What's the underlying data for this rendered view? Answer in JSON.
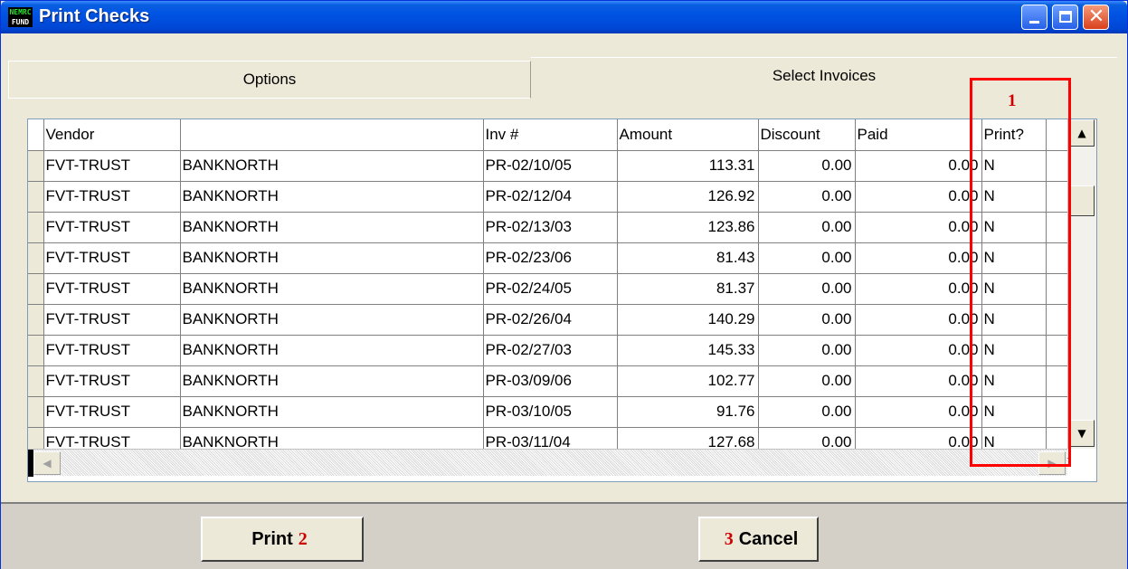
{
  "window": {
    "title": "Print Checks",
    "icon_top": "NEMRC",
    "icon_bottom": "FUND"
  },
  "tabs": [
    {
      "label": "Options",
      "active": false
    },
    {
      "label": "Select Invoices",
      "active": true
    }
  ],
  "table": {
    "headers": [
      "Vendor",
      "",
      "Inv #",
      "Amount",
      "Discount",
      "Paid",
      "Print?",
      ""
    ],
    "rows": [
      [
        "FVT-TRUST",
        "BANKNORTH",
        "PR-02/10/05",
        "113.31",
        "0.00",
        "0.00",
        "N"
      ],
      [
        "FVT-TRUST",
        "BANKNORTH",
        "PR-02/12/04",
        "126.92",
        "0.00",
        "0.00",
        "N"
      ],
      [
        "FVT-TRUST",
        "BANKNORTH",
        "PR-02/13/03",
        "123.86",
        "0.00",
        "0.00",
        "N"
      ],
      [
        "FVT-TRUST",
        "BANKNORTH",
        "PR-02/23/06",
        "81.43",
        "0.00",
        "0.00",
        "N"
      ],
      [
        "FVT-TRUST",
        "BANKNORTH",
        "PR-02/24/05",
        "81.37",
        "0.00",
        "0.00",
        "N"
      ],
      [
        "FVT-TRUST",
        "BANKNORTH",
        "PR-02/26/04",
        "140.29",
        "0.00",
        "0.00",
        "N"
      ],
      [
        "FVT-TRUST",
        "BANKNORTH",
        "PR-02/27/03",
        "145.33",
        "0.00",
        "0.00",
        "N"
      ],
      [
        "FVT-TRUST",
        "BANKNORTH",
        "PR-03/09/06",
        "102.77",
        "0.00",
        "0.00",
        "N"
      ],
      [
        "FVT-TRUST",
        "BANKNORTH",
        "PR-03/10/05",
        "91.76",
        "0.00",
        "0.00",
        "N"
      ],
      [
        "FVT-TRUST",
        "BANKNORTH",
        "PR-03/11/04",
        "127.68",
        "0.00",
        "0.00",
        "N"
      ]
    ]
  },
  "annotations": {
    "one": "1",
    "two": "2",
    "three": "3",
    "color": "#ff0000"
  },
  "buttons": {
    "print": "Print",
    "cancel": "Cancel"
  }
}
